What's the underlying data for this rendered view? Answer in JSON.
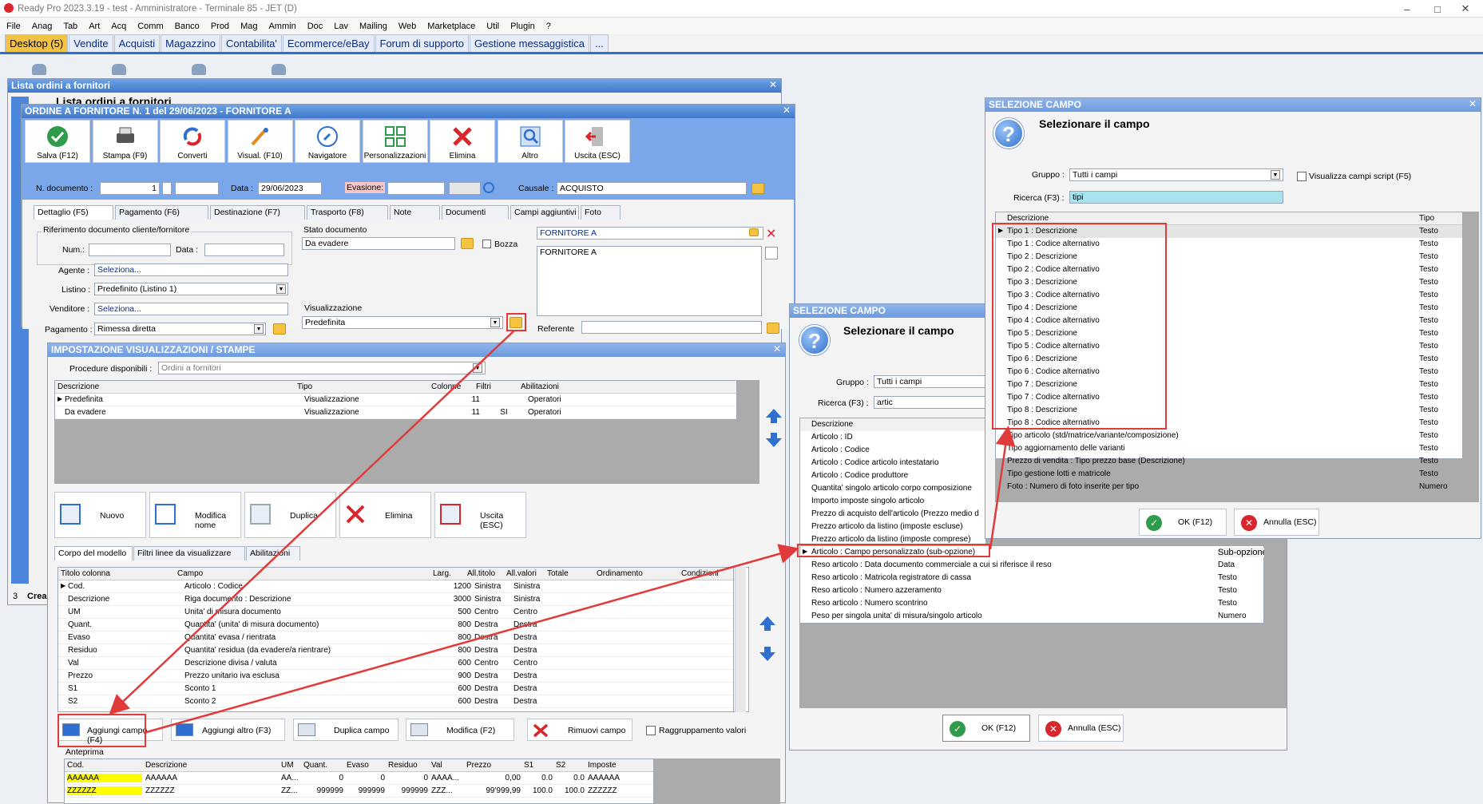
{
  "app": {
    "title": "Ready Pro 2023.3.19 - test - Amministratore - Terminale 85 - JET (D)"
  },
  "menu": [
    "File",
    "Anag",
    "Tab",
    "Art",
    "Acq",
    "Comm",
    "Banco",
    "Prod",
    "Mag",
    "Ammin",
    "Doc",
    "Lav",
    "Mailing",
    "Web",
    "Marketplace",
    "Util",
    "Plugin",
    "?"
  ],
  "desktop_tabs": [
    "Desktop (5)",
    "Vendite",
    "Acquisti",
    "Magazzino",
    "Contabilita'",
    "Ecommerce/eBay",
    "Forum di supporto",
    "Gestione messaggistica",
    "..."
  ],
  "lista": {
    "title": "Lista ordini a fornitori",
    "sub_title": "Lista ordini a fornitori",
    "row_num": "3",
    "crea": "Crea"
  },
  "ordine": {
    "title": "ORDINE A FORNITORE N. 1 del 29/06/2023 - FORNITORE A",
    "toolbar": [
      "Salva (F12)",
      "Stampa (F9)",
      "Converti",
      "Visual. (F10)",
      "Navigatore",
      "Personalizzazioni",
      "Elimina",
      "Altro",
      "Uscita (ESC)"
    ],
    "ndoc_label": "N. documento :",
    "ndoc_value": "1",
    "data_label": "Data :",
    "data_value": "29/06/2023",
    "evasione_label": "Evasione:",
    "causale_label": "Causale :",
    "causale_value": "ACQUISTO",
    "tabs": [
      "Dettaglio (F5)",
      "Pagamento (F6)",
      "Destinazione (F7)",
      "Trasporto (F8)",
      "Note",
      "Documenti",
      "Campi aggiuntivi",
      "Foto"
    ],
    "rif_title": "Riferimento documento cliente/fornitore",
    "num_label": "Num.:",
    "data2_label": "Data :",
    "stato_title": "Stato documento",
    "stato_value": "Da evadere",
    "bozza": "Bozza",
    "fornitore_head": "FORNITORE A",
    "fornitore_body": "FORNITORE A",
    "agente_label": "Agente :",
    "agente_value": "Seleziona...",
    "listino_label": "Listino :",
    "listino_value": "Predefinito (Listino 1)",
    "venditore_label": "Venditore :",
    "venditore_value": "Seleziona...",
    "pagamento_label": "Pagamento :",
    "pagamento_value": "Rimessa diretta",
    "visual_title": "Visualizzazione",
    "visual_value": "Predefinita",
    "referente_label": "Referente"
  },
  "impost": {
    "title": "IMPOSTAZIONE VISUALIZZAZIONI / STAMPE",
    "proc_label": "Procedure disponibili :",
    "proc_value": "Ordini a fornitori",
    "grid_headers": [
      "Descrizione",
      "Tipo",
      "Colonne",
      "Filtri",
      "Abilitazioni"
    ],
    "grid_rows": [
      [
        "Predefinita",
        "Visualizzazione",
        "11",
        "",
        "Operatori"
      ],
      [
        "Da evadere",
        "Visualizzazione",
        "11",
        "SI",
        "Operatori"
      ]
    ],
    "buttons": [
      "Nuovo",
      "Modifica nome",
      "Duplica",
      "Elimina",
      "Uscita (ESC)"
    ],
    "tabs": [
      "Corpo del modello",
      "Filtri linee da visualizzare",
      "Abilitazioni"
    ],
    "col_headers": [
      "Titolo colonna",
      "Campo",
      "Larg.",
      "All.titolo",
      "All.valori",
      "Totale",
      "Ordinamento",
      "Condizioni"
    ],
    "col_rows": [
      [
        "Cod.",
        "Articolo : Codice",
        "1200",
        "Sinistra",
        "Sinistra"
      ],
      [
        "Descrizione",
        "Riga documento : Descrizione",
        "3000",
        "Sinistra",
        "Sinistra"
      ],
      [
        "UM",
        "Unita' di misura documento",
        "500",
        "Centro",
        "Centro"
      ],
      [
        "Quant.",
        "Quantita' (unita' di misura documento)",
        "800",
        "Destra",
        "Destra"
      ],
      [
        "Evaso",
        "Quantita' evasa / rientrata",
        "800",
        "Destra",
        "Destra"
      ],
      [
        "Residuo",
        "Quantita' residua (da evadere/a rientrare)",
        "800",
        "Destra",
        "Destra"
      ],
      [
        "Val",
        "Descrizione divisa / valuta",
        "600",
        "Centro",
        "Centro"
      ],
      [
        "Prezzo",
        "Prezzo unitario iva esclusa",
        "900",
        "Destra",
        "Destra"
      ],
      [
        "S1",
        "Sconto 1",
        "600",
        "Destra",
        "Destra"
      ],
      [
        "S2",
        "Sconto 2",
        "600",
        "Destra",
        "Destra"
      ]
    ],
    "bottom_buttons": [
      "Aggiungi campo (F4)",
      "Aggiungi altro (F3)",
      "Duplica campo",
      "Modifica (F2)",
      "Rimuovi campo"
    ],
    "raggr": "Raggruppamento valori",
    "anteprima": "Anteprima",
    "ant_headers": [
      "Cod.",
      "Descrizione",
      "UM",
      "Quant.",
      "Evaso",
      "Residuo",
      "Val",
      "Prezzo",
      "S1",
      "S2",
      "Imposte"
    ],
    "ant_rows": [
      [
        "AAAAAA",
        "AAAAAA",
        "AA...",
        "0",
        "0",
        "0",
        "AAAA...",
        "0,00",
        "0.0",
        "0.0",
        "AAAAAA"
      ],
      [
        "ZZZZZZ",
        "ZZZZZZ",
        "ZZ...",
        "999999",
        "999999",
        "999999",
        "ZZZ...",
        "99'999,99",
        "100.0",
        "100.0",
        "ZZZZZZ"
      ]
    ]
  },
  "sel1": {
    "title": "SELEZIONE CAMPO",
    "heading": "Selezionare il campo",
    "gruppo_label": "Gruppo :",
    "gruppo_value": "Tutti i campi",
    "ricerca_label": "Ricerca (F3) :",
    "ricerca_value": "artic",
    "col_desc": "Descrizione",
    "rows": [
      "Articolo : ID",
      "Articolo : Codice",
      "Articolo : Codice articolo intestatario",
      "Articolo : Codice produttore",
      "Quantita' singolo articolo corpo composizione",
      "Importo imposte singolo articolo",
      "Prezzo di acquisto dell'articolo (Prezzo medio d",
      "Prezzo articolo da listino (imposte escluse)",
      "Prezzo articolo da listino (imposte comprese)"
    ],
    "col_sub": "Sub-opzione",
    "sub_rows": [
      [
        "Articolo : Campo personalizzato (sub-opzione)",
        ""
      ],
      [
        "Reso articolo : Data documento commerciale a cui si riferisce il reso",
        "Data"
      ],
      [
        "Reso articolo : Matricola registratore di cassa",
        "Testo"
      ],
      [
        "Reso articolo : Numero azzeramento",
        "Testo"
      ],
      [
        "Reso articolo : Numero scontrino",
        "Testo"
      ],
      [
        "Peso per singola unita' di misura/singolo articolo",
        "Numero"
      ]
    ],
    "ok": "OK (F12)",
    "annulla": "Annulla (ESC)"
  },
  "sel2": {
    "title": "SELEZIONE CAMPO",
    "heading": "Selezionare il campo",
    "gruppo_label": "Gruppo :",
    "gruppo_value": "Tutti i campi",
    "script_label": "Visualizza campi script (F5)",
    "ricerca_label": "Ricerca (F3) :",
    "ricerca_value": "tipi",
    "col_desc": "Descrizione",
    "col_tipo": "Tipo",
    "rows": [
      [
        "Tipo 1 : Descrizione",
        "Testo"
      ],
      [
        "Tipo 1 : Codice alternativo",
        "Testo"
      ],
      [
        "Tipo 2 : Descrizione",
        "Testo"
      ],
      [
        "Tipo 2 : Codice alternativo",
        "Testo"
      ],
      [
        "Tipo 3 : Descrizione",
        "Testo"
      ],
      [
        "Tipo 3 : Codice alternativo",
        "Testo"
      ],
      [
        "Tipo 4 : Descrizione",
        "Testo"
      ],
      [
        "Tipo 4 : Codice alternativo",
        "Testo"
      ],
      [
        "Tipo 5 : Descrizione",
        "Testo"
      ],
      [
        "Tipo 5 : Codice alternativo",
        "Testo"
      ],
      [
        "Tipo 6 : Descrizione",
        "Testo"
      ],
      [
        "Tipo 6 : Codice alternativo",
        "Testo"
      ],
      [
        "Tipo 7 : Descrizione",
        "Testo"
      ],
      [
        "Tipo 7 : Codice alternativo",
        "Testo"
      ],
      [
        "Tipo 8 : Descrizione",
        "Testo"
      ],
      [
        "Tipo 8 : Codice alternativo",
        "Testo"
      ],
      [
        "Tipo articolo (std/matrice/variante/composizione)",
        "Testo"
      ],
      [
        "Tipo aggiornamento delle varianti",
        "Testo"
      ],
      [
        "Prezzo di vendita : Tipo prezzo base (Descrizione)",
        "Testo"
      ],
      [
        "Tipo gestione lotti e matricole",
        "Testo"
      ],
      [
        "Foto : Numero di foto inserite per tipo",
        "Numero"
      ]
    ],
    "ok": "OK (F12)",
    "annulla": "Annulla (ESC)"
  },
  "colors": {
    "accent": "#3f78cc",
    "highlight": "#e03a3a",
    "yellow": "#ffff00",
    "tab_active": "#f5c242"
  }
}
